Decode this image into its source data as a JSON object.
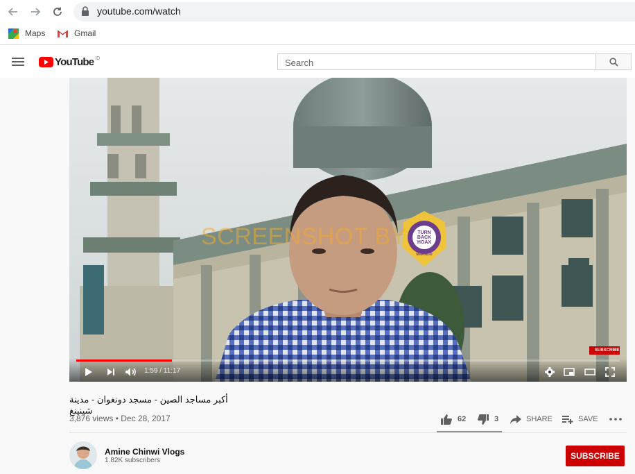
{
  "browser": {
    "url": "youtube.com/watch",
    "bookmarks": [
      {
        "label": "Maps",
        "icon": "maps-icon"
      },
      {
        "label": "Gmail",
        "icon": "gmail-icon"
      }
    ]
  },
  "header": {
    "logo_text": "YouTube",
    "region": "ID",
    "search_placeholder": "Search"
  },
  "video": {
    "watermark": "SCREENSHOT BY",
    "badge": {
      "top": "TURN",
      "mid": "BACK",
      "bot": "HOAX",
      "ring": "MASYARAKAT ANTI FITNAH INDONESIA",
      "bottom": "MAFINDO"
    },
    "subscribe_overlay": "SUBSCRIBE",
    "time": "1:59 / 11:17",
    "progress": 0.176,
    "title": "أكبر مساجد الصين - مسجد دونغوان - مدينة شينينغ",
    "views": "3,876 views",
    "date": "Dec 28, 2017",
    "likes": "62",
    "dislikes": "3",
    "share_label": "SHARE",
    "save_label": "SAVE"
  },
  "channel": {
    "name": "Amine Chinwi Vlogs",
    "subscribers": "1.82K subscribers",
    "subscribe_label": "SUBSCRIBE"
  },
  "colors": {
    "brand_red": "#ff0000",
    "subscribe_red": "#cc0000",
    "progress_red": "#ff0000"
  }
}
